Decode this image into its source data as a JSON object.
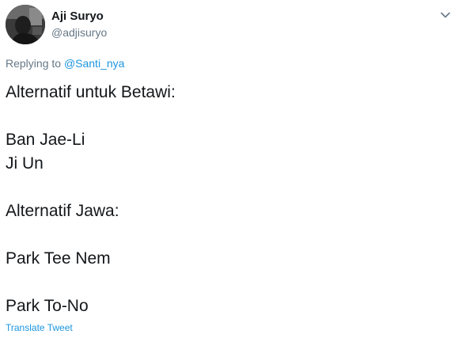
{
  "author": {
    "name": "Aji Suryo",
    "handle": "@adjisuryo",
    "avatar_icon": "profile-photo"
  },
  "menu_icon": "chevron-down-icon",
  "reply": {
    "prefix": "Replying to",
    "mention": "@Santi_nya"
  },
  "tweet_lines": [
    "Alternatif untuk Betawi:",
    "",
    "Ban Jae-Li",
    "Ji Un",
    "",
    "Alternatif Jawa:",
    "",
    "Park Tee Nem",
    "",
    "Park To-No"
  ],
  "translate_label": "Translate Tweet",
  "colors": {
    "text": "#14171a",
    "secondary": "#657786",
    "link": "#1b95e0"
  }
}
